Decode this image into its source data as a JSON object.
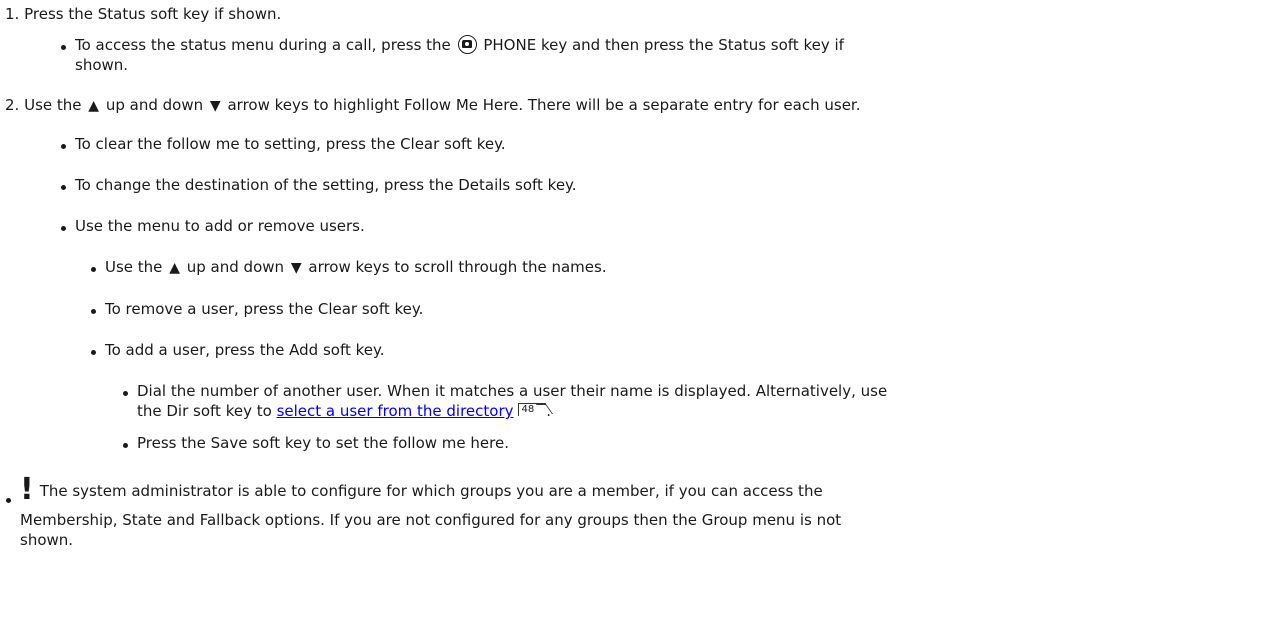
{
  "steps": [
    {
      "num": "1.",
      "text": "Press the Status soft key if shown."
    },
    {
      "num": "2.",
      "text_before": "Use the",
      "text_mid": "up and down",
      "text_after": "arrow keys to highlight Follow Me Here. There will be a separate entry for each user."
    }
  ],
  "step1_bullet": {
    "line1_before": "To access the status menu during a call, press the",
    "line1_after": "PHONE key and then press the Status soft key if",
    "line2": "shown."
  },
  "step2_bullets": [
    "To clear the follow me to setting, press the Clear soft key.",
    "To change the destination of the setting, press the Details soft key.",
    "Use the menu to add or remove users."
  ],
  "menu_bullets": {
    "scroll_before": "Use the",
    "scroll_mid": "up and down",
    "scroll_after": "arrow keys to scroll through the names.",
    "remove": "To remove a user, press the Clear soft key.",
    "add": "To add a user, press the Add soft key."
  },
  "add_bullets": {
    "dial_line1": "Dial the number of another user. When it matches a user their name is displayed.  Alternatively, use",
    "dial_line2_before": "the Dir soft key to",
    "dial_link": "select a user from the directory",
    "dial_pageref": "48",
    "dial_line2_after": ".",
    "save": "Press the Save soft key to set the follow me here."
  },
  "note": {
    "mark": "!",
    "line1": "The system administrator is able to configure for which groups you are a member, if you can access the",
    "line2": "Membership, State and Fallback options. If you are not configured for any groups then the Group menu is not",
    "line3": "shown."
  },
  "icons": {
    "phone_key": "phone-key-icon",
    "up_arrow": "up-arrow-icon",
    "down_arrow": "down-arrow-icon",
    "up_glyph": "▲",
    "down_glyph": "▼",
    "page_ref": "page-reference-icon"
  },
  "colors": {
    "link": "#0000ee",
    "text": "#1a1a1a"
  }
}
